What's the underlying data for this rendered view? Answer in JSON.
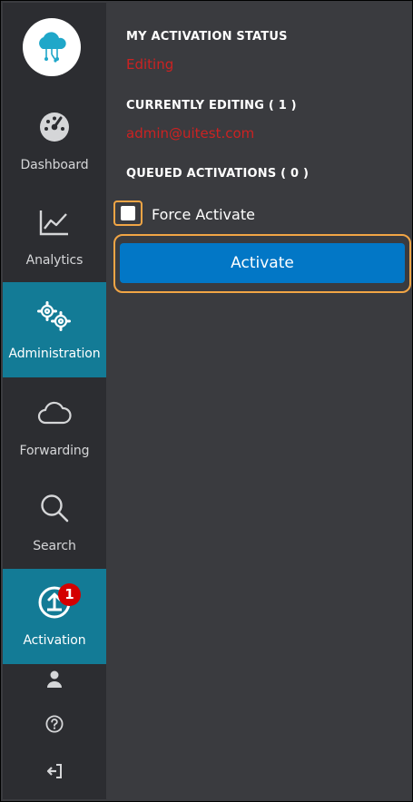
{
  "sidebar": {
    "items": [
      {
        "label": "Dashboard",
        "icon": "dashboard-gauge-icon",
        "active": false
      },
      {
        "label": "Analytics",
        "icon": "analytics-chart-icon",
        "active": false
      },
      {
        "label": "Administration",
        "icon": "gears-icon",
        "active": true
      },
      {
        "label": "Forwarding",
        "icon": "cloud-icon",
        "active": false
      },
      {
        "label": "Search",
        "icon": "search-icon",
        "active": false
      },
      {
        "label": "Activation",
        "icon": "upload-activation-icon",
        "active": true,
        "badge": "1"
      }
    ],
    "bottom_icons": [
      "user-icon",
      "help-icon",
      "sign-out-icon"
    ]
  },
  "main": {
    "my_activation_status_title": "MY ACTIVATION STATUS",
    "my_activation_status_value": "Editing",
    "currently_editing_title": "CURRENTLY EDITING ( 1 )",
    "currently_editing_value": "admin@uitest.com",
    "queued_activations_title": "QUEUED ACTIVATIONS ( 0 )",
    "force_activate_label": "Force Activate",
    "force_activate_checked": false,
    "activate_button_label": "Activate"
  },
  "colors": {
    "sidebar_bg": "#2c2d31",
    "content_bg": "#3a3b3f",
    "active_nav": "#137b96",
    "primary_button": "#0277c6",
    "status_red": "#cc2222",
    "highlight_outline": "#f1a545",
    "badge_red": "#d40000"
  }
}
